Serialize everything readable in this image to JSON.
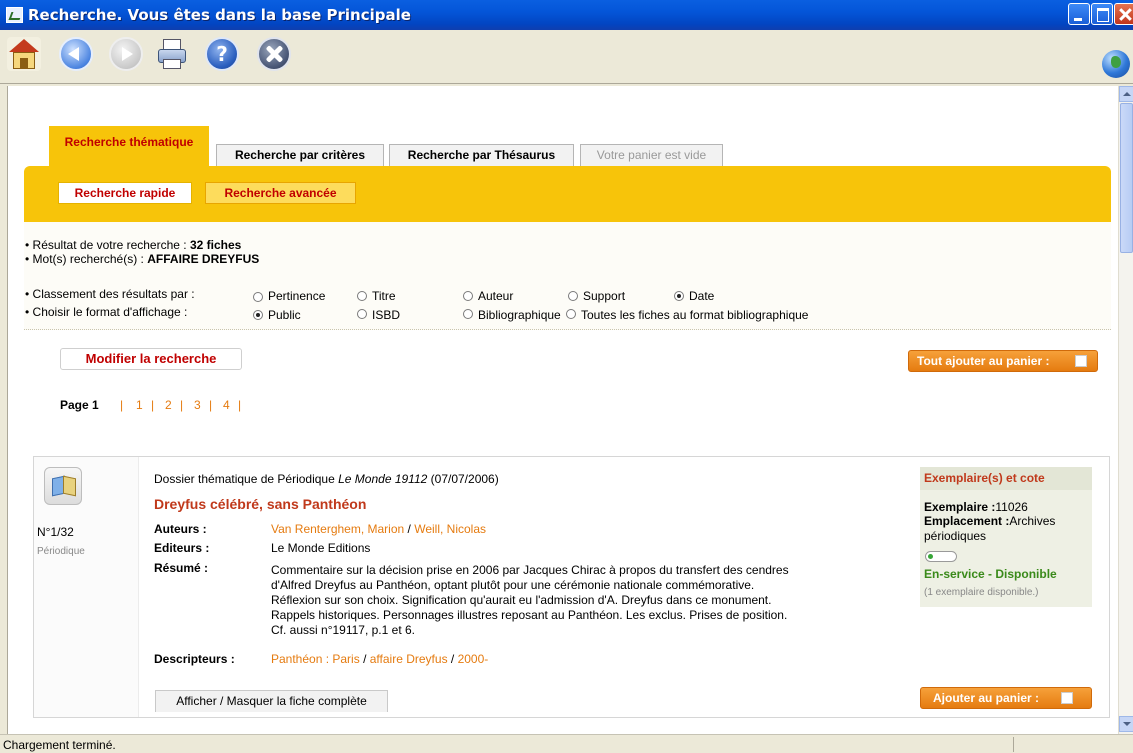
{
  "window": {
    "title": "Recherche. Vous êtes dans la base Principale"
  },
  "toolbar": {
    "buttons": [
      "home-icon",
      "back-icon",
      "forward-icon",
      "print-icon",
      "help-icon",
      "stop-icon"
    ],
    "help_glyph": "?"
  },
  "tabs": [
    {
      "label": "Recherche thématique",
      "state": "active"
    },
    {
      "label": "Recherche par critères",
      "state": "normal"
    },
    {
      "label": "Recherche par Thésaurus",
      "state": "normal"
    },
    {
      "label": "Votre panier est vide",
      "state": "disabled"
    }
  ],
  "subtabs": [
    "Recherche rapide",
    "Recherche avancée"
  ],
  "summary": {
    "result_label": "• Résultat de votre recherche : ",
    "result_value": "32 fiches",
    "words_label": "• Mot(s) recherché(s) : ",
    "words_value": "AFFAIRE DREYFUS"
  },
  "sort": {
    "label": "• Classement des résultats par :",
    "options": [
      "Pertinence",
      "Titre",
      "Auteur",
      "Support",
      "Date"
    ],
    "selected": "Date"
  },
  "format": {
    "label": "• Choisir le format d'affichage :",
    "options": [
      "Public",
      "ISBD",
      "Bibliographique",
      "Toutes les fiches au format bibliographique"
    ],
    "selected": "Public"
  },
  "actions": {
    "modify_label": "Modifier la recherche",
    "add_all_label": "Tout ajouter au panier :"
  },
  "pager": {
    "label": "Page 1",
    "pages": [
      "1",
      "2",
      "3",
      "4"
    ],
    "separator": "|"
  },
  "result": {
    "number": "N°1/32",
    "type": "Périodique",
    "source_prefix": "Dossier thématique de Périodique",
    "source_title": "Le Monde 19112",
    "source_date": "(07/07/2006)",
    "title": "Dreyfus célébré, sans Panthéon",
    "authors_label": "Auteurs :",
    "authors": [
      "Van Renterghem, Marion",
      "Weill, Nicolas"
    ],
    "editors_label": "Editeurs :",
    "editors": "Le Monde Editions",
    "summary_label": "Résumé :",
    "summary_lines": [
      "Commentaire sur la décision prise en 2006 par Jacques Chirac à propos du transfert des cendres",
      "d'Alfred Dreyfus au Panthéon, optant plutôt pour une cérémonie nationale commémorative.",
      "Réflexion sur son choix. Signification qu'aurait eu l'admission d'A. Dreyfus dans ce monument.",
      "Rappels historiques. Personnages illustres reposant au Panthéon. Les exclus. Prises de position.",
      "Cf. aussi n°19117, p.1 et 6."
    ],
    "descriptors_label": "Descripteurs :",
    "descriptors": [
      "Panthéon : Paris",
      "affaire Dreyfus",
      "2000-"
    ],
    "toggle_label": "Afficher / Masquer la fiche complète",
    "add_label": "Ajouter au panier :"
  },
  "copies": {
    "header": "Exemplaire(s) et cote",
    "copy_label": "Exemplaire :",
    "copy_value": "11026",
    "location_label": "Emplacement :",
    "location_value_1": "Archives",
    "location_value_2": "périodiques",
    "status": "En-service - Disponible",
    "availability": "(1 exemplaire disponible.)"
  },
  "status_bar": {
    "text": "Chargement terminé."
  },
  "colors": {
    "accent_yellow": "#f7c40a",
    "accent_red": "#c00000",
    "link_orange": "#e57b10",
    "available_green": "#3a8a1a"
  }
}
